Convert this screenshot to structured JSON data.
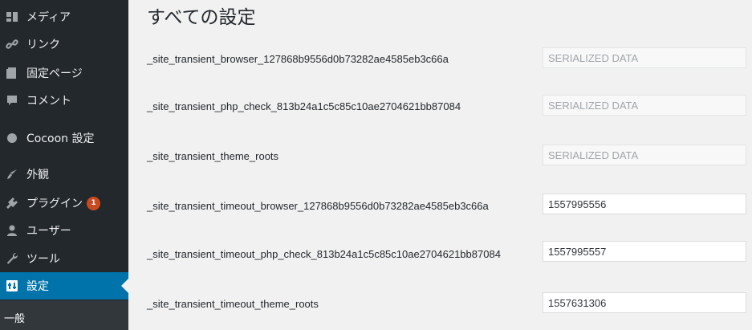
{
  "sidebar": {
    "items": [
      {
        "label": "メディア",
        "icon": "media-icon"
      },
      {
        "label": "リンク",
        "icon": "link-icon"
      },
      {
        "label": "固定ページ",
        "icon": "page-icon"
      },
      {
        "label": "コメント",
        "icon": "comment-icon"
      },
      {
        "label": "Cocoon 設定",
        "icon": "cocoon-icon"
      },
      {
        "label": "外観",
        "icon": "appearance-icon"
      },
      {
        "label": "プラグイン",
        "icon": "plugin-icon",
        "badge": "1"
      },
      {
        "label": "ユーザー",
        "icon": "user-icon"
      },
      {
        "label": "ツール",
        "icon": "tools-icon"
      },
      {
        "label": "設定",
        "icon": "settings-icon",
        "active": true
      }
    ],
    "submenu": {
      "label": "一般"
    }
  },
  "main": {
    "title": "すべての設定",
    "options": [
      {
        "name": "_site_transient_browser_127868b9556d0b73282ae4585eb3c66a",
        "value": "SERIALIZED DATA",
        "disabled": true
      },
      {
        "name": "_site_transient_php_check_813b24a1c5c85c10ae2704621bb87084",
        "value": "SERIALIZED DATA",
        "disabled": true
      },
      {
        "name": "_site_transient_theme_roots",
        "value": "SERIALIZED DATA",
        "disabled": true
      },
      {
        "name": "_site_transient_timeout_browser_127868b9556d0b73282ae4585eb3c66a",
        "value": "1557995556",
        "disabled": false
      },
      {
        "name": "_site_transient_timeout_php_check_813b24a1c5c85c10ae2704621bb87084",
        "value": "1557995557",
        "disabled": false
      },
      {
        "name": "_site_transient_timeout_theme_roots",
        "value": "1557631306",
        "disabled": false
      }
    ]
  },
  "colors": {
    "sidebar_bg": "#23282d",
    "active_bg": "#0073aa",
    "badge_bg": "#ca4a1f",
    "page_bg": "#f1f1f1"
  }
}
